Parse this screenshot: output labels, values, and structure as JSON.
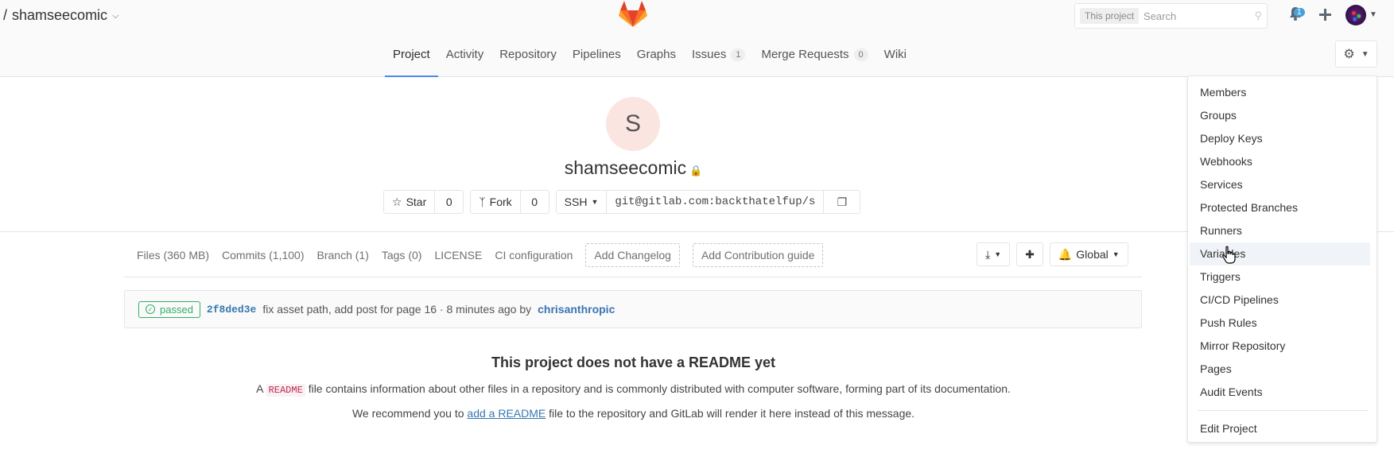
{
  "header": {
    "project_prefix": "/",
    "project_name": "shamseecomic",
    "search_scope": "This project",
    "search_placeholder": "Search",
    "todo_count": "1"
  },
  "nav": {
    "tabs": [
      {
        "label": "Project",
        "active": true
      },
      {
        "label": "Activity"
      },
      {
        "label": "Repository"
      },
      {
        "label": "Pipelines"
      },
      {
        "label": "Graphs"
      },
      {
        "label": "Issues",
        "count": "1"
      },
      {
        "label": "Merge Requests",
        "count": "0"
      },
      {
        "label": "Wiki"
      }
    ]
  },
  "project": {
    "avatar_letter": "S",
    "title": "shamseecomic",
    "star_label": "Star",
    "star_count": "0",
    "fork_label": "Fork",
    "fork_count": "0",
    "protocol": "SSH",
    "clone_url": "git@gitlab.com:backthatelfup/s"
  },
  "stats": {
    "files": "Files (360 MB)",
    "commits": "Commits (1,100)",
    "branch": "Branch (1)",
    "tags": "Tags (0)",
    "license": "LICENSE",
    "ci_config": "CI configuration",
    "add_changelog": "Add Changelog",
    "add_contribution": "Add Contribution guide",
    "notification": "Global"
  },
  "commit": {
    "status": "passed",
    "sha": "2f8ded3e",
    "message": "fix asset path, add post for page 16 · 8 minutes ago by",
    "author": "chrisanthropic"
  },
  "readme": {
    "title": "This project does not have a README yet",
    "line1_prefix": "A",
    "line1_code": "README",
    "line1_suffix": "file contains information about other files in a repository and is commonly distributed with computer software, forming part of its documentation.",
    "line2_prefix": "We recommend you to",
    "line2_link": "add a README",
    "line2_suffix": "file to the repository and GitLab will render it here instead of this message."
  },
  "settings_menu": {
    "items": [
      "Members",
      "Groups",
      "Deploy Keys",
      "Webhooks",
      "Services",
      "Protected Branches",
      "Runners",
      "Variables",
      "Triggers",
      "CI/CD Pipelines",
      "Push Rules",
      "Mirror Repository",
      "Pages",
      "Audit Events"
    ],
    "hovered": "Variables",
    "edit_project": "Edit Project"
  },
  "colors": {
    "accent": "#4a8bee",
    "link": "#3777b0",
    "passed": "#31af64"
  }
}
